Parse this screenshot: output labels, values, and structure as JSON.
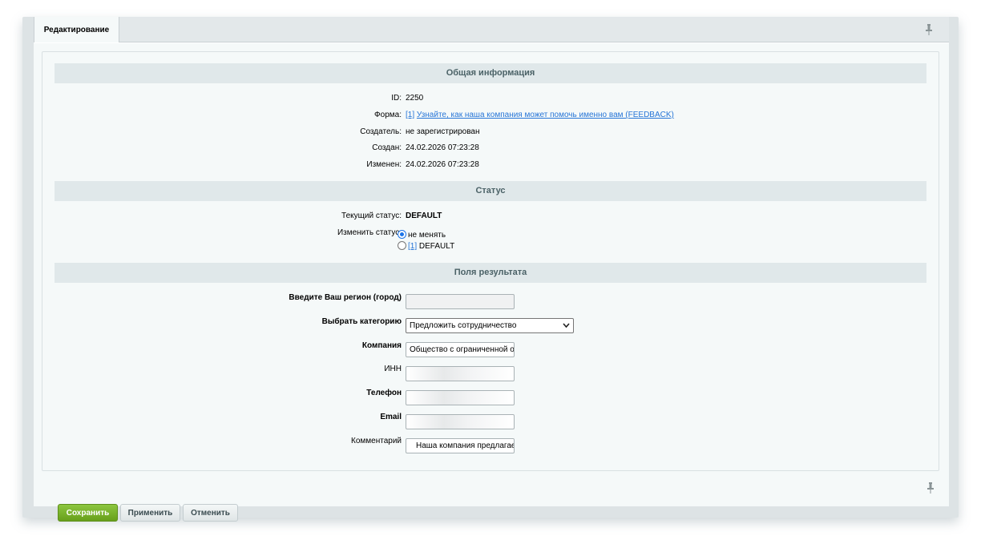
{
  "tabs": [
    {
      "label": "Редактирование"
    }
  ],
  "sections": {
    "general": "Общая информация",
    "status": "Статус",
    "result_fields": "Поля результата"
  },
  "info": {
    "id_label": "ID:",
    "id_value": "2250",
    "form_label": "Форма:",
    "form_id": "[1]",
    "form_link": "Узнайте, как наша компания может помочь именно вам (FEEDBACK)",
    "creator_label": "Создатель:",
    "creator_value": "не зарегистрирован",
    "created_label": "Создан:",
    "created_value": "24.02.2026 07:23:28",
    "modified_label": "Изменен:",
    "modified_value": "24.02.2026 07:23:28"
  },
  "status": {
    "current_label": "Текущий статус:",
    "current_value": "DEFAULT",
    "change_label": "Изменить статус:",
    "options": [
      {
        "label": "не менять",
        "selected": true
      },
      {
        "id": "[1]",
        "label": "DEFAULT",
        "selected": false
      }
    ]
  },
  "fields": {
    "region": {
      "label": "Введите Ваш регион (город)",
      "value": ""
    },
    "category": {
      "label": "Выбрать категорию",
      "value": "Предложить сотрудничество"
    },
    "company": {
      "label": "Компания",
      "value": "Общество с ограниченной ответственностью"
    },
    "inn": {
      "label": "ИНН",
      "value": ""
    },
    "phone": {
      "label": "Телефон",
      "value": ""
    },
    "email": {
      "label": "Email",
      "value": ""
    },
    "comment": {
      "label": "Комментарий",
      "value": "Наша компания предлагает"
    }
  },
  "buttons": {
    "save": "Сохранить",
    "apply": "Применить",
    "cancel": "Отменить"
  },
  "colors": {
    "save_button": "#7cb72f",
    "link": "#2675d7",
    "section_header_bg": "#e0e8ea"
  },
  "icons": [
    "pin-icon",
    "chevron-down-icon"
  ]
}
